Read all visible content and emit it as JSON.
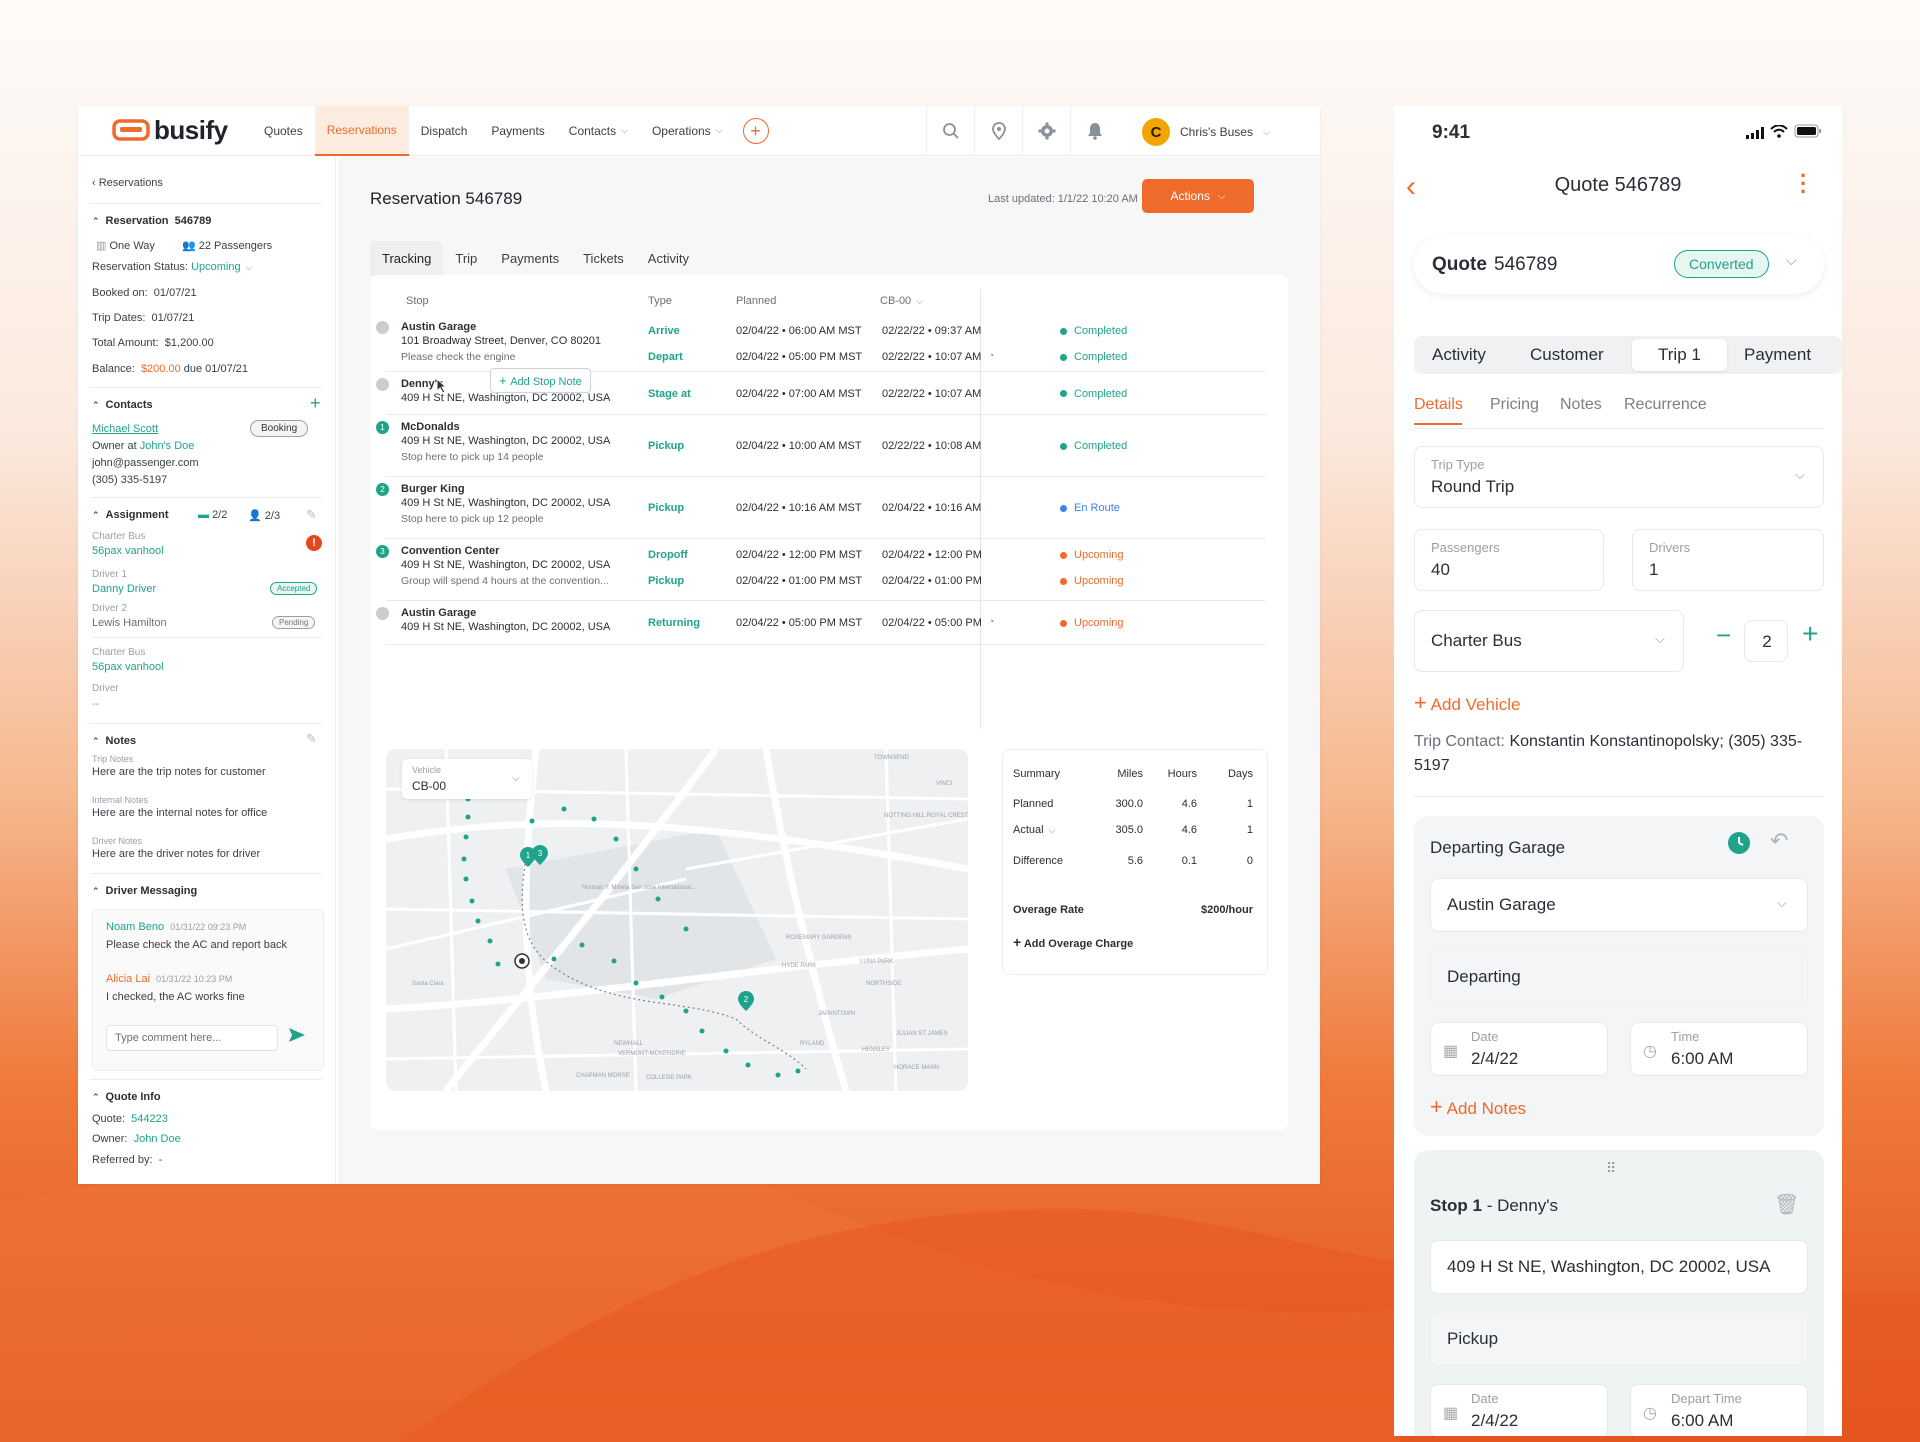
{
  "brand": {
    "name": "busify",
    "accent": "#ef6b2c",
    "teal": "#1fa38a"
  },
  "nav": {
    "items": [
      {
        "label": "Quotes",
        "active": false
      },
      {
        "label": "Reservations",
        "active": true
      },
      {
        "label": "Dispatch",
        "active": false
      },
      {
        "label": "Payments",
        "active": false
      },
      {
        "label": "Contacts",
        "active": false
      },
      {
        "label": "Operations",
        "active": false
      }
    ],
    "icons": [
      "search-icon",
      "location-pin-icon",
      "gear-icon",
      "bell-icon"
    ],
    "account_initial": "C",
    "account_name": "Chris's Buses"
  },
  "sidebar": {
    "back": "Reservations",
    "reservation_label": "Reservation",
    "reservation_id": "546789",
    "trip_kind": "One Way",
    "passengers": "22 Passengers",
    "status_label": "Reservation Status:",
    "status_value": "Upcoming",
    "booked_label": "Booked on:",
    "booked_value": "01/07/21",
    "trip_dates_label": "Trip Dates:",
    "trip_dates_value": "01/07/21",
    "total_label": "Total Amount:",
    "total_value": "$1,200.00",
    "balance_label": "Balance:",
    "balance_value": "$200.00",
    "balance_due": "due 01/07/21",
    "contacts_title": "Contacts",
    "contact_name": "Michael Scott",
    "contact_badge": "Booking",
    "contact_owner_prefix": "Owner at",
    "contact_owner_company": "John's Doe",
    "contact_email": "john@passenger.com",
    "contact_phone": "(305) 335-5197",
    "assignment_title": "Assignment",
    "assignment_vehicles": "2/2",
    "assignment_drivers": "2/3",
    "charter_bus_label": "Charter Bus",
    "charter_bus_1": "56pax vanhool",
    "driver1_label": "Driver 1",
    "driver1_name": "Danny Driver",
    "driver1_status": "Accepted",
    "driver2_label": "Driver 2",
    "driver2_name": "Lewis Hamilton",
    "driver2_status": "Pending",
    "charter_bus_label_2": "Charter Bus",
    "charter_bus_2": "56pax vanhool",
    "driver_label": "Driver",
    "driver_value": "--",
    "notes_title": "Notes",
    "trip_notes_label": "Trip Notes",
    "trip_notes": "Here are the trip notes for customer",
    "internal_notes_label": "Internal Notes",
    "internal_notes": "Here are the internal notes for office",
    "driver_notes_label": "Driver Notes",
    "driver_notes": "Here are the driver notes for driver",
    "messaging_title": "Driver Messaging",
    "messages": [
      {
        "author": "Noam Beno",
        "time": "01/31/22 09:23 PM",
        "text": "Please check the AC and report back"
      },
      {
        "author": "Alicia Lai",
        "time": "01/31/22 10:23 PM",
        "text": "I checked, the AC works fine"
      }
    ],
    "comment_placeholder": "Type comment here...",
    "quote_info_title": "Quote Info",
    "quote_label": "Quote:",
    "quote_value": "544223",
    "owner_label": "Owner:",
    "owner_value": "John Doe",
    "referred_label": "Referred by:",
    "referred_value": "-"
  },
  "main": {
    "title": "Reservation 546789",
    "last_updated": "Last updated: 1/1/22 10:20 AM",
    "actions_label": "Actions",
    "tabs": [
      "Tracking",
      "Trip",
      "Payments",
      "Tickets",
      "Activity"
    ],
    "columns": {
      "stop": "Stop",
      "type": "Type",
      "planned": "Planned",
      "vehicle": "CB-00"
    },
    "add_stop_note": "Add Stop Note",
    "stops": [
      {
        "badge": "",
        "name": "Austin Garage",
        "address": "101 Broadway Street, Denver, CO 80201",
        "note": "Please check the engine",
        "lines": [
          {
            "type": "Arrive",
            "planned": "02/04/22  •  06:00 AM MST",
            "actual": "02/22/22  •  09:37 AM",
            "status": "Completed",
            "status_color": "#1fa38a"
          },
          {
            "type": "Depart",
            "planned": "02/04/22  •  05:00 PM MST",
            "actual": "02/22/22  •  10:07 AM",
            "status": "Completed",
            "status_color": "#1fa38a"
          }
        ]
      },
      {
        "badge": "",
        "name": "Denny's",
        "address": "409 H St NE, Washington, DC 20002, USA",
        "note": "",
        "lines": [
          {
            "type": "Stage at",
            "planned": "02/04/22  •  07:00 AM MST",
            "actual": "02/22/22  •  10:07 AM",
            "status": "Completed",
            "status_color": "#1fa38a"
          }
        ]
      },
      {
        "badge": "1",
        "name": "McDonalds",
        "address": "409 H St NE, Washington, DC 20002, USA",
        "note": "Stop here to pick up 14 people",
        "lines": [
          {
            "type": "Pickup",
            "planned": "02/04/22  •  10:00 AM MST",
            "actual": "02/22/22  •  10:08 AM",
            "status": "Completed",
            "status_color": "#1fa38a"
          }
        ]
      },
      {
        "badge": "2",
        "name": "Burger King",
        "address": "409 H St NE, Washington, DC 20002, USA",
        "note": "Stop here to pick up 12 people",
        "lines": [
          {
            "type": "Pickup",
            "planned": "02/04/22  •  10:16 AM MST",
            "actual": "02/04/22  •  10:16 AM",
            "status": "En Route",
            "status_color": "#3b82f6"
          }
        ]
      },
      {
        "badge": "3",
        "name": "Convention Center",
        "address": "409 H St NE, Washington, DC 20002, USA",
        "note": "Group will spend 4 hours at the convention...",
        "lines": [
          {
            "type": "Dropoff",
            "planned": "02/04/22  •  12:00 PM MST",
            "actual": "02/04/22  •  12:00 PM",
            "status": "Upcoming",
            "status_color": "#ef6b2c"
          },
          {
            "type": "Pickup",
            "planned": "02/04/22  •  01:00 PM MST",
            "actual": "02/04/22  •  01:00 PM",
            "status": "Upcoming",
            "status_color": "#ef6b2c"
          }
        ]
      },
      {
        "badge": "",
        "name": "Austin Garage",
        "address": "409 H St NE, Washington, DC 20002, USA",
        "note": "",
        "lines": [
          {
            "type": "Returning",
            "planned": "02/04/22  •  05:00 PM MST",
            "actual": "02/04/22  •  05:00 PM",
            "status": "Upcoming",
            "status_color": "#ef6b2c"
          }
        ]
      }
    ],
    "map": {
      "vehicle_label": "Vehicle",
      "vehicle_value": "CB-00",
      "labels": [
        "TOWNSEND",
        "NOTTING HILL ROYAL CREST",
        "Norman Y. Mineta San Jose International...",
        "ROSEMARY GARDENS",
        "HYDE PARK",
        "LUNA PARK",
        "NORTHSIDE",
        "JAPANTOWN",
        "JULIAN ST JAMES",
        "HENSLEY",
        "HORACE MANN",
        "NEWHALL",
        "VERMONT-MCKENDRIE",
        "CHAPMAN MORSE",
        "COLLEGE PARK",
        "Santa Clara",
        "RYLAND",
        "VINCI"
      ]
    },
    "summary": {
      "headers": [
        "Summary",
        "Miles",
        "Hours",
        "Days"
      ],
      "rows": [
        {
          "label": "Planned",
          "miles": "300.0",
          "hours": "4.6",
          "days": "1"
        },
        {
          "label": "Actual",
          "miles": "305.0",
          "hours": "4.6",
          "days": "1"
        },
        {
          "label": "Difference",
          "miles": "5.6",
          "hours": "0.1",
          "days": "0"
        }
      ],
      "overage_label": "Overage Rate",
      "overage_value": "$200/hour",
      "add_overage": "Add Overage Charge"
    }
  },
  "mobile": {
    "time": "9:41",
    "title": "Quote 546789",
    "quote_label": "Quote",
    "quote_id": "546789",
    "quote_status": "Converted",
    "tabs": [
      "Activity",
      "Customer",
      "Trip 1",
      "Payment"
    ],
    "subtabs": [
      "Details",
      "Pricing",
      "Notes",
      "Recurrence"
    ],
    "trip_type_label": "Trip Type",
    "trip_type_value": "Round Trip",
    "passengers_label": "Passengers",
    "passengers_value": "40",
    "drivers_label": "Drivers",
    "drivers_value": "1",
    "vehicle_type": "Charter Bus",
    "vehicle_qty": "2",
    "add_vehicle": "Add Vehicle",
    "trip_contact_label": "Trip Contact:",
    "trip_contact_value": "Konstantin Konstantinopolsky; (305) 335-5197",
    "departing_title": "Departing Garage",
    "departing_garage": "Austin Garage",
    "departing_type": "Departing",
    "date_label": "Date",
    "date_value": "2/4/22",
    "time_label": "Time",
    "time_value": "6:00 AM",
    "add_notes": "Add Notes",
    "stop_prefix": "Stop 1",
    "stop_name": "- Denny's",
    "stop_address": "409 H St NE, Washington, DC 20002, USA",
    "stop_type": "Pickup",
    "stop_date_label": "Date",
    "stop_date_value": "2/4/22",
    "stop_time_label": "Depart Time",
    "stop_time_value": "6:00 AM"
  }
}
